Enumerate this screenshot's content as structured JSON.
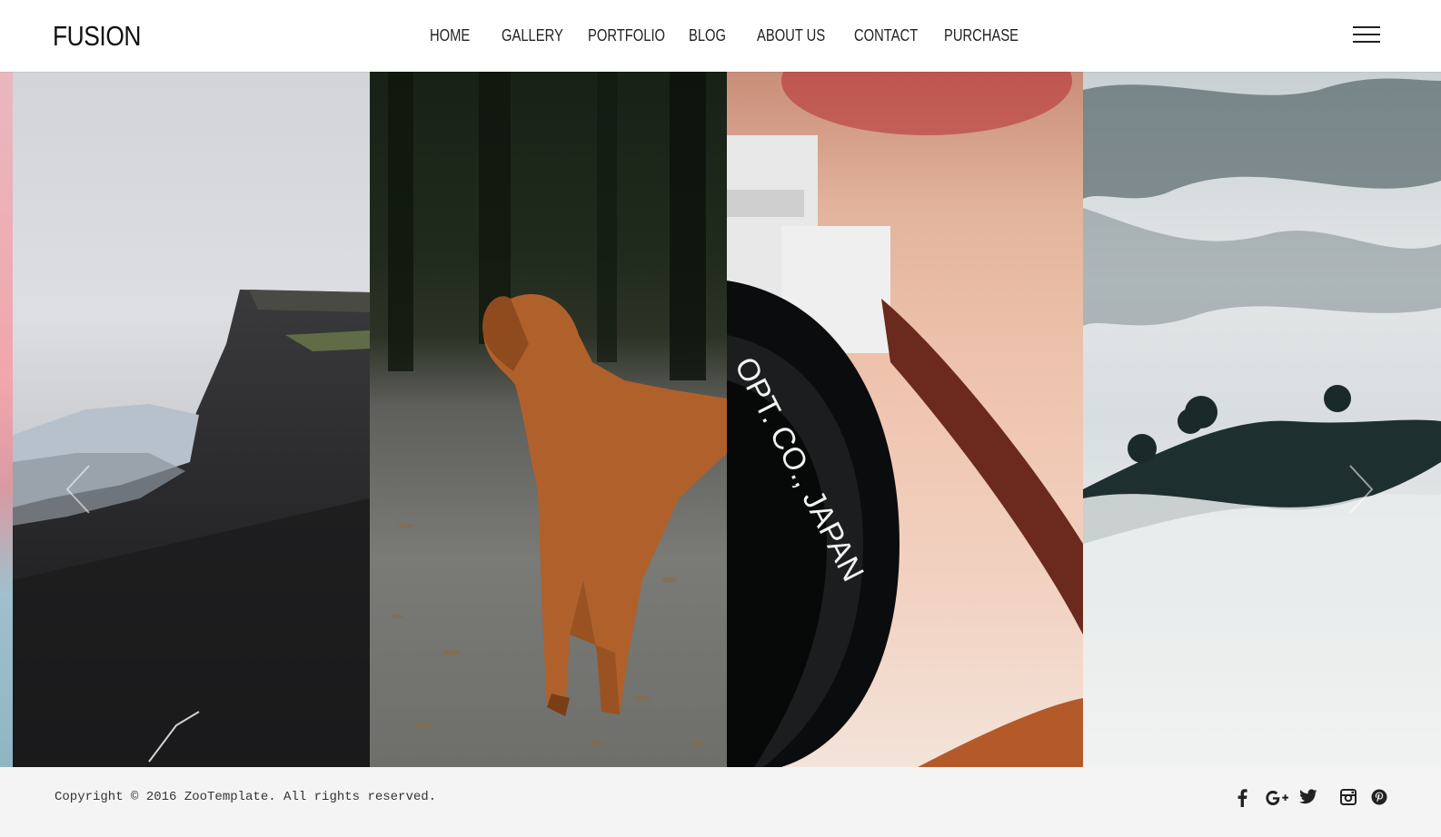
{
  "brand": {
    "logo": "FUSION"
  },
  "nav": {
    "items": [
      {
        "label": "HOME"
      },
      {
        "label": "GALLERY"
      },
      {
        "label": "PORTFOLIO"
      },
      {
        "label": "BLOG"
      },
      {
        "label": "ABOUT US"
      },
      {
        "label": "CONTACT"
      },
      {
        "label": "PURCHASE"
      }
    ],
    "menu_icon": "hamburger-icon"
  },
  "gallery": {
    "slides": [
      {
        "subject": "rocky-cliff"
      },
      {
        "subject": "golden-retriever"
      },
      {
        "subject": "camera-lens",
        "lens_text": "OPT. CO., JAPAN"
      },
      {
        "subject": "foggy-hills"
      }
    ],
    "prev_icon": "chevron-left-icon",
    "next_icon": "chevron-right-icon"
  },
  "footer": {
    "copyright": "Copyright © 2016 ZooTemplate. All rights reserved.",
    "social": [
      "facebook-icon",
      "google-plus-icon",
      "twitter-icon",
      "instagram-icon",
      "pinterest-icon"
    ]
  },
  "colors": {
    "text": "#222222",
    "footer_bg": "#f4f4f4"
  }
}
